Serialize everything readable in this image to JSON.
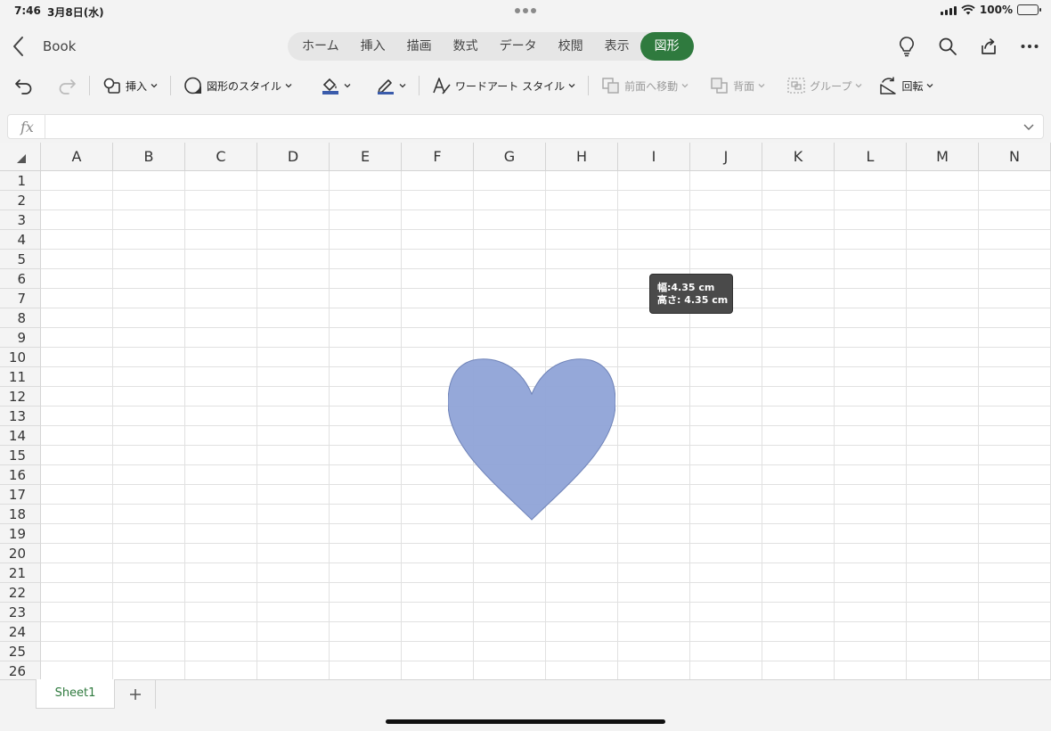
{
  "status_bar": {
    "time": "7:46",
    "date": "3月8日(水)",
    "battery": "100%"
  },
  "header": {
    "book_title": "Book",
    "tabs": [
      {
        "label": "ホーム"
      },
      {
        "label": "挿入"
      },
      {
        "label": "描画"
      },
      {
        "label": "数式"
      },
      {
        "label": "データ"
      },
      {
        "label": "校閲"
      },
      {
        "label": "表示"
      },
      {
        "label": "図形"
      }
    ],
    "active_tab": "図形"
  },
  "ribbon": {
    "insert": "挿入",
    "shape_styles": "図形のスタイル",
    "wordart_styles": "ワードアート スタイル",
    "bring_forward": "前面へ移動",
    "send_backward": "背面",
    "group": "グループ",
    "rotate": "回転"
  },
  "formula_bar": {
    "fx": "fx",
    "value": ""
  },
  "grid": {
    "columns": [
      "A",
      "B",
      "C",
      "D",
      "E",
      "F",
      "G",
      "H",
      "I",
      "J",
      "K",
      "L",
      "M",
      "N"
    ],
    "rows": [
      "1",
      "2",
      "3",
      "4",
      "5",
      "6",
      "7",
      "8",
      "9",
      "10",
      "11",
      "12",
      "13",
      "14",
      "15",
      "16",
      "17",
      "18",
      "19",
      "20",
      "21",
      "22",
      "23",
      "24",
      "25",
      "26"
    ]
  },
  "shape": {
    "type": "heart",
    "fill_color": "#8fa3d7",
    "stroke_color": "#6f83b8",
    "tooltip_width": "幅:4.35 cm",
    "tooltip_height": "高さ: 4.35 cm"
  },
  "sheets": {
    "tabs": [
      "Sheet1"
    ],
    "active": "Sheet1",
    "add_label": "+"
  },
  "colors": {
    "accent": "#2f7a3e"
  }
}
